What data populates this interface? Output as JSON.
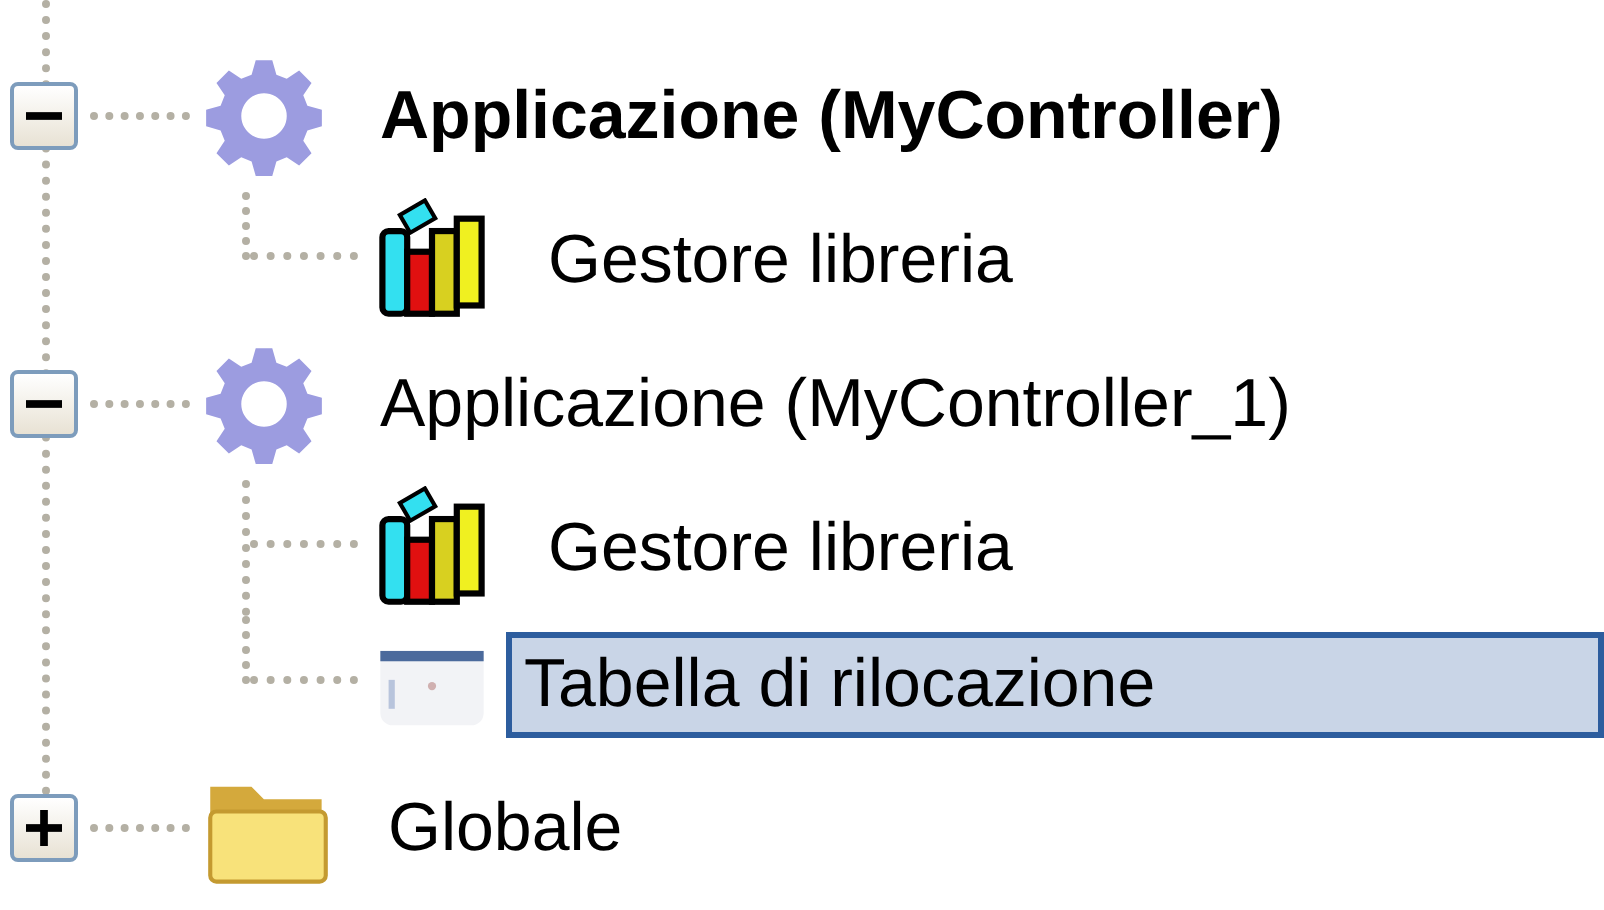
{
  "tree": [
    {
      "label": "Applicazione (MyController)",
      "kind": "gear",
      "active": true,
      "expanded": true,
      "selected": false,
      "children": [
        {
          "label": "Gestore libreria",
          "kind": "library",
          "selected": false
        }
      ]
    },
    {
      "label": "Applicazione (MyController_1)",
      "kind": "gear",
      "active": false,
      "expanded": true,
      "selected": false,
      "children": [
        {
          "label": "Gestore libreria",
          "kind": "library",
          "selected": false
        },
        {
          "label": "Tabella di rilocazione",
          "kind": "table",
          "selected": true
        }
      ]
    },
    {
      "label": "Globale",
      "kind": "folder",
      "active": false,
      "expanded": false,
      "selected": false
    }
  ]
}
